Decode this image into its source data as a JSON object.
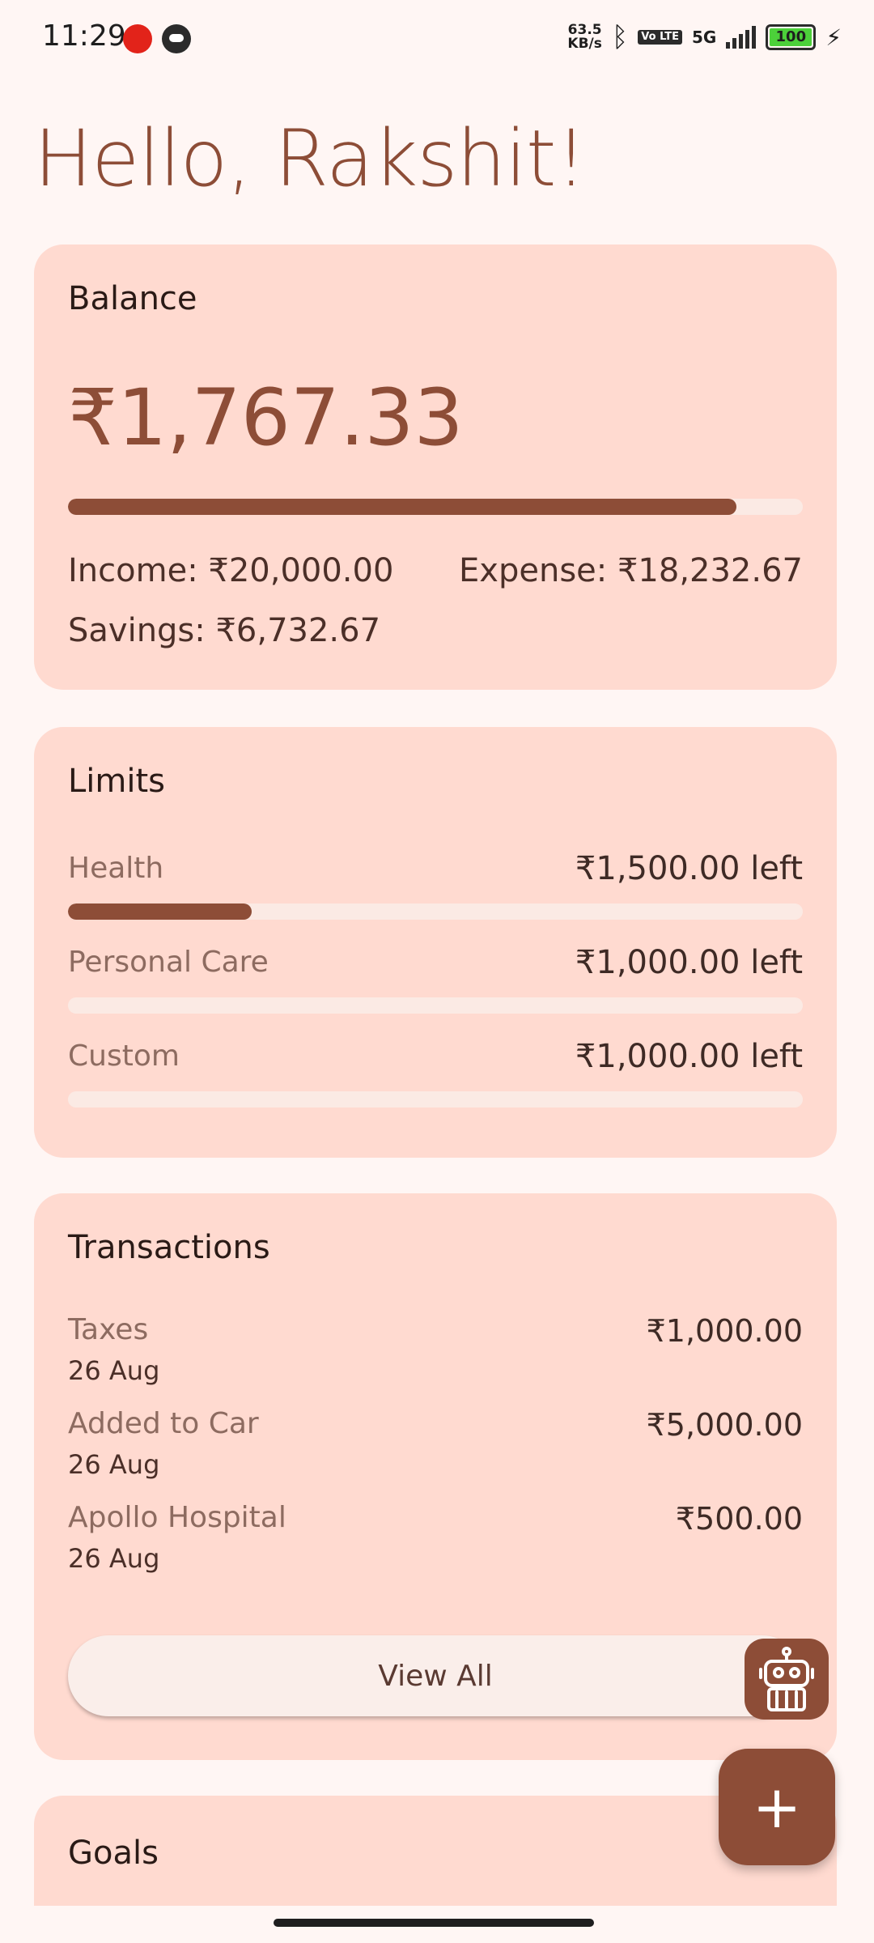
{
  "status_bar": {
    "time": "11:29",
    "net_speed_value": "63.5",
    "net_speed_unit": "KB/s",
    "volte": "Vo LTE",
    "network": "5G",
    "battery": "100"
  },
  "greeting": "Hello, Rakshit!",
  "balance": {
    "title": "Balance",
    "amount": "₹1,767.33",
    "spent_fraction": 0.91,
    "income": "Income: ₹20,000.00",
    "expense": "Expense: ₹18,232.67",
    "savings": "Savings: ₹6,732.67"
  },
  "limits": {
    "title": "Limits",
    "items": [
      {
        "name": "Health",
        "left": "₹1,500.00 left",
        "used_fraction": 0.25
      },
      {
        "name": "Personal Care",
        "left": "₹1,000.00 left",
        "used_fraction": 0
      },
      {
        "name": "Custom",
        "left": "₹1,000.00 left",
        "used_fraction": 0
      }
    ]
  },
  "transactions": {
    "title": "Transactions",
    "items": [
      {
        "name": "Taxes",
        "date": "26 Aug",
        "amount": "₹1,000.00"
      },
      {
        "name": "Added to Car",
        "date": "26 Aug",
        "amount": "₹5,000.00"
      },
      {
        "name": "Apollo Hospital",
        "date": "26 Aug",
        "amount": "₹500.00"
      }
    ],
    "view_all_label": "View All"
  },
  "goals": {
    "title": "Goals"
  },
  "fab": {
    "add_label": "+"
  },
  "colors": {
    "accent": "#8d4d37",
    "card": "#ffdad0",
    "background": "#fff6f4",
    "track": "#fbeae4"
  }
}
